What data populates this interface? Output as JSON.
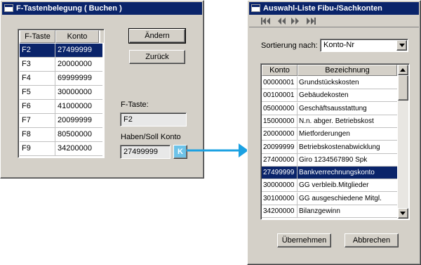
{
  "window1": {
    "title": "F-Tastenbelegung  ( Buchen )",
    "columns": [
      "F-Taste",
      "Konto"
    ],
    "rows": [
      {
        "key": "F2",
        "konto": "27499999"
      },
      {
        "key": "F3",
        "konto": "20000000"
      },
      {
        "key": "F4",
        "konto": "69999999"
      },
      {
        "key": "F5",
        "konto": "30000000"
      },
      {
        "key": "F6",
        "konto": "41000000"
      },
      {
        "key": "F7",
        "konto": "20099999"
      },
      {
        "key": "F8",
        "konto": "80500000"
      },
      {
        "key": "F9",
        "konto": "34200000"
      }
    ],
    "selected_index": 0,
    "aendern_label": "Ändern",
    "zurueck_label": "Zurück",
    "ftaste_label": "F-Taste:",
    "ftaste_value": "F2",
    "konto_label": "Haben/Soll Konto",
    "konto_value": "27499999",
    "lookup_button_label": "K"
  },
  "window2": {
    "title": "Auswahl-Liste Fibu-/Sachkonten",
    "nav_buttons": [
      "first-icon",
      "prev-icon",
      "next-icon",
      "last-icon"
    ],
    "sort_label": "Sortierung nach:",
    "sort_value": "Konto-Nr",
    "columns": [
      "Konto",
      "Bezeichnung"
    ],
    "rows": [
      {
        "konto": "00000001",
        "bez": "Grundstückskosten"
      },
      {
        "konto": "00100001",
        "bez": "Gebäudekosten"
      },
      {
        "konto": "05000000",
        "bez": "Geschäftsausstattung"
      },
      {
        "konto": "15000000",
        "bez": "N.n. abger. Betriebskost"
      },
      {
        "konto": "20000000",
        "bez": "Mietforderungen"
      },
      {
        "konto": "20099999",
        "bez": "Betriebskostenabwicklung"
      },
      {
        "konto": "27400000",
        "bez": "Giro 1234567890 Spk"
      },
      {
        "konto": "27499999",
        "bez": "Bankverrechnungskonto"
      },
      {
        "konto": "30000000",
        "bez": "GG verbleib.Mitglieder"
      },
      {
        "konto": "30100000",
        "bez": "GG ausgeschiedene Mitgl."
      },
      {
        "konto": "34200000",
        "bez": "Bilanzgewinn"
      }
    ],
    "selected_index": 7,
    "ok_label": "Übernehmen",
    "cancel_label": "Abbrechen"
  },
  "colors": {
    "selection": "#0a246a",
    "arrow": "#1ba1e2",
    "lookup_button": "#6ec3e8"
  }
}
